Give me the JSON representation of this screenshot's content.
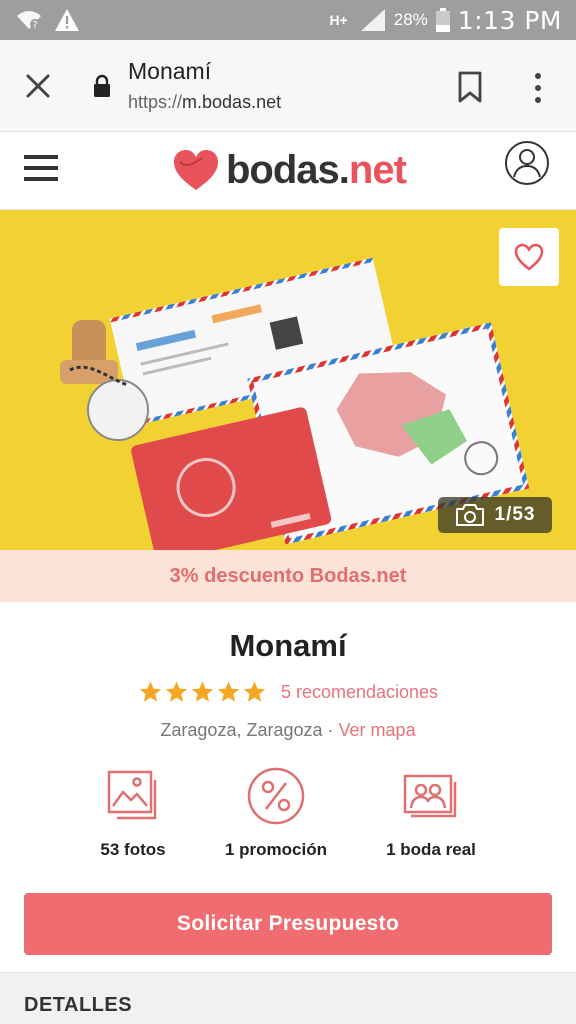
{
  "status_bar": {
    "network": "H+",
    "battery": "28%",
    "time": "1:13 PM",
    "icons": [
      "wifi-icon",
      "warning-icon",
      "signal-icon",
      "battery-icon"
    ]
  },
  "browser": {
    "title": "Monamí",
    "url_scheme": "https://",
    "url_host": "m.bodas.net"
  },
  "site": {
    "logo_text_main": "bodas.",
    "logo_text_accent": "net",
    "brand_color": "#e9545c"
  },
  "hero": {
    "photo_counter": "1/53"
  },
  "promo_banner": "3% descuento Bodas.net",
  "vendor": {
    "name": "Monamí",
    "rating_stars": 5,
    "recommendations": "5 recomendaciones",
    "location": "Zaragoza, Zaragoza",
    "separator": "·",
    "map_link": "Ver mapa"
  },
  "stats": [
    {
      "icon": "photos-icon",
      "label": "53 fotos"
    },
    {
      "icon": "percent-icon",
      "label": "1 promoción"
    },
    {
      "icon": "real-wedding-icon",
      "label": "1 boda real"
    }
  ],
  "cta_label": "Solicitar Presupuesto",
  "section_title": "DETALLES",
  "colors": {
    "accent": "#ef6d70",
    "link": "#e8737a",
    "star": "#f5a623",
    "hero_bg": "#f2d232",
    "promo_bg": "#fde2d8"
  }
}
